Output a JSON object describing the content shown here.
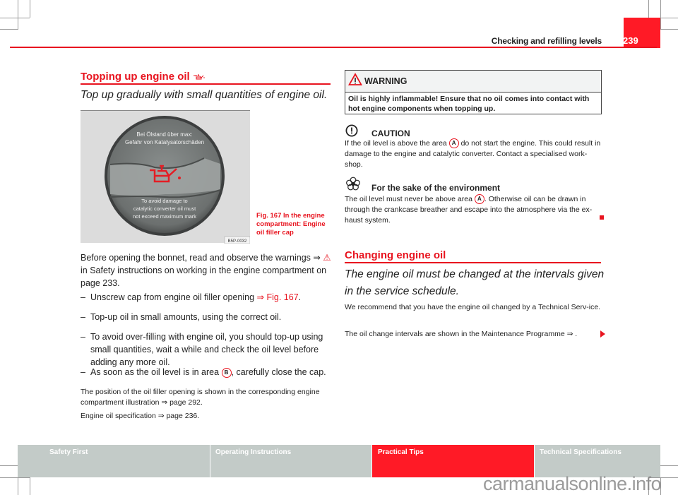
{
  "header": {
    "chapter_title": "Checking and refilling levels",
    "page_number": "239"
  },
  "left": {
    "section_title": "Topping up engine oil",
    "section_icon": "oil-can-icon",
    "lead": "Top up gradually with small quantities of engine oil.",
    "figure": {
      "cap_text_top_line1": "Bei Ölstand über max:",
      "cap_text_top_line2": "Gefahr von Katalysatorschäden",
      "cap_text_bottom_line1": "To avoid damage to",
      "cap_text_bottom_line2": "catalytic converter oil must",
      "cap_text_bottom_line3": "not exceed maximum mark",
      "code": "B5P-0032",
      "caption": "Fig. 167   In the engine compartment: Engine oil filler cap"
    },
    "intro_part1": "Before opening the bonnet, read and observe the warnings ⇒ ",
    "intro_part2": " in Safety instructions on working in the engine compartment on page 233.",
    "steps": [
      {
        "text": "Unscrew cap from engine oil filler opening ",
        "link": "⇒ Fig. 167",
        "after": "."
      },
      {
        "text": "Top-up oil in small amounts, using the correct oil."
      },
      {
        "text": "To avoid over-filling with engine oil, you should top-up using small quantities, wait a while and check the oil level before adding any more oil."
      },
      {
        "text": "As soon as the oil level is in area ",
        "marker": "B",
        "after": ", carefully close the cap."
      }
    ],
    "dash": "–",
    "note1": "The position of the oil filler opening is shown in the corresponding engine compartment illustration ⇒ page 292.",
    "note2": "Engine oil specification ⇒ page 236."
  },
  "right": {
    "warning": {
      "title": "WARNING",
      "text": "Oil is highly inflammable! Ensure that no oil comes into contact with hot engine components when topping up."
    },
    "caution": {
      "title": "CAUTION",
      "text_part1": "If the oil level is above the area ",
      "marker": "A",
      "text_part2": " do not start the engine. This could result in damage to the engine and catalytic converter. Contact a specialised work-shop."
    },
    "environment": {
      "title": "For the sake of the environment",
      "text_part1": "The oil level must never be above area ",
      "marker": "A",
      "text_part2": ". Otherwise oil can be drawn in through the crankcase breather and escape into the atmosphere via the ex-haust system."
    },
    "section2_title": "Changing engine oil",
    "section2_lead": "The engine oil must be changed at the intervals given in the service schedule.",
    "para1": "We recommend that you have the engine oil changed by a Technical Serv-ice.",
    "para2": "The oil change intervals are shown in the Maintenance Programme ⇒ ."
  },
  "footer": {
    "tabs": [
      {
        "label": "Safety First",
        "active": false
      },
      {
        "label": "Operating Instructions",
        "active": false
      },
      {
        "label": "Practical Tips",
        "active": true
      },
      {
        "label": "Technical Specifications",
        "active": false
      }
    ],
    "watermark": "carmanualsonline.info"
  },
  "colors": {
    "accent": "#e8141f",
    "tab_active": "#ff1a26",
    "tab_inactive": "#c3cbc8"
  }
}
